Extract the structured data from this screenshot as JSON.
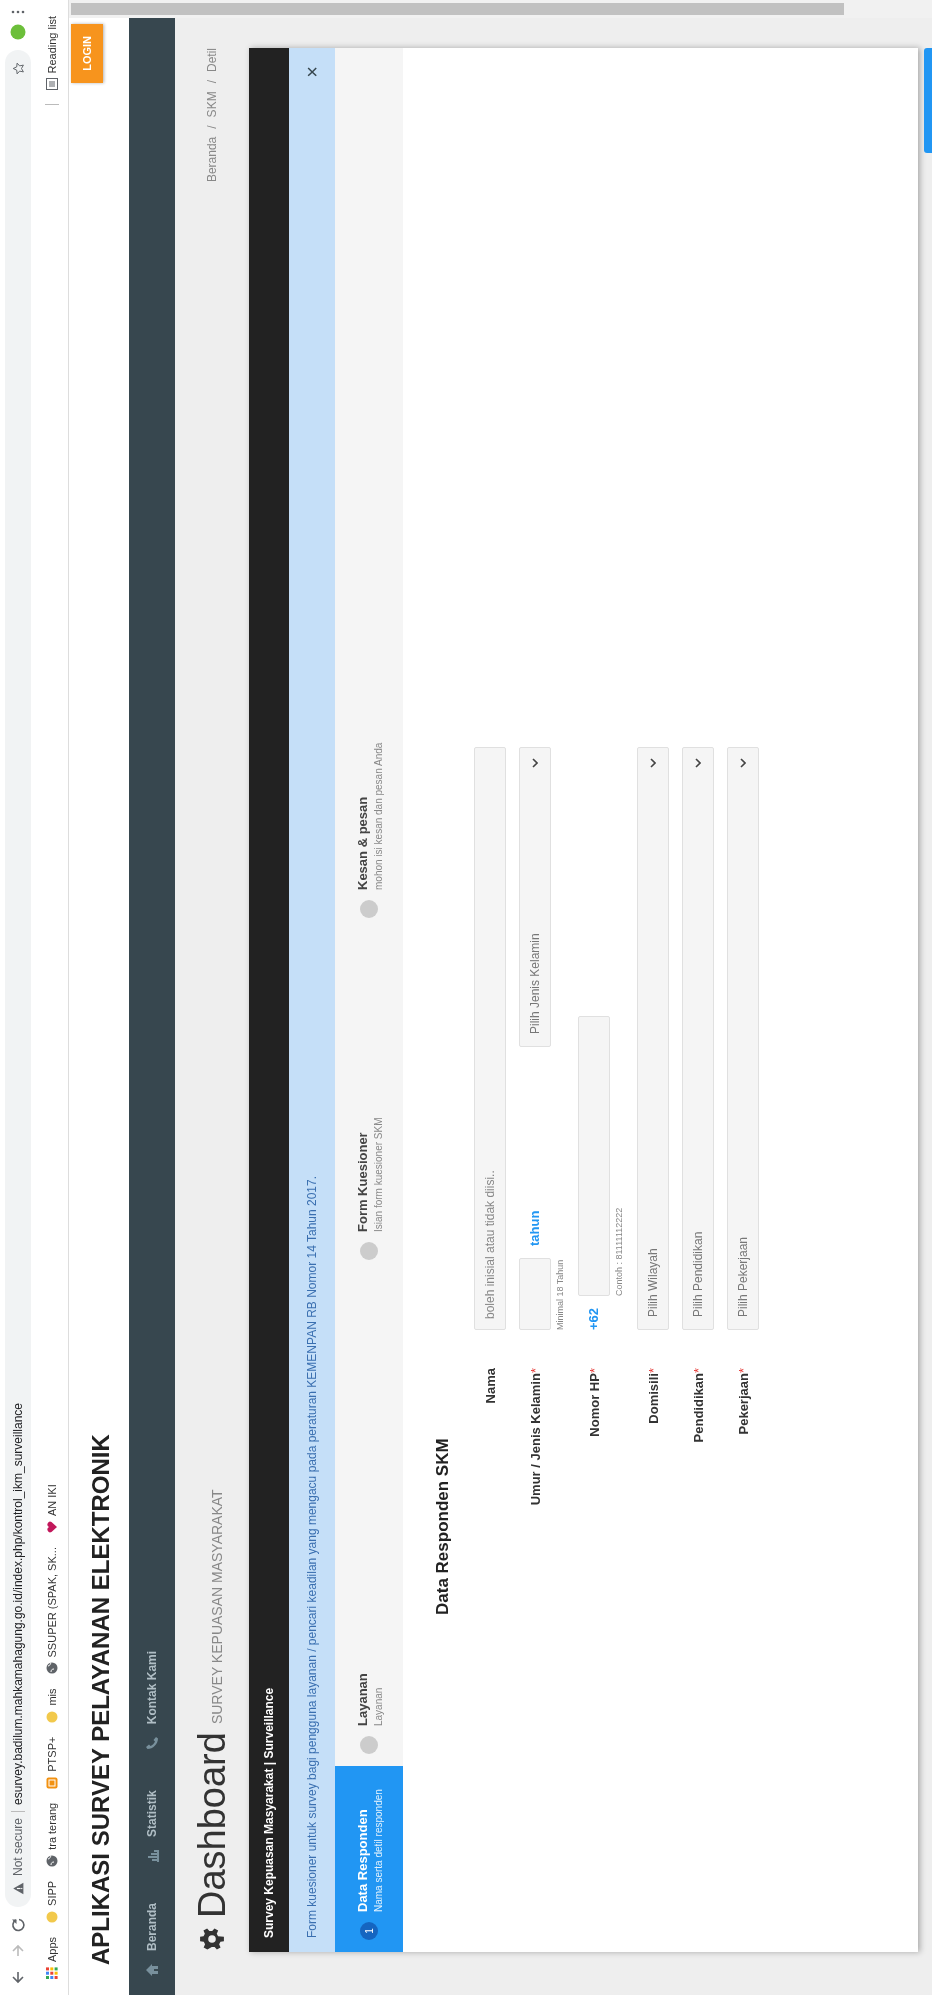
{
  "browser": {
    "security": "Not secure",
    "url": "esurvey.badilum.mahkamahagung.go.id/index.php/kontrol_ikm_surveillance",
    "bookmarks": [
      {
        "label": "Apps",
        "kind": "apps"
      },
      {
        "label": "SIPP",
        "kind": "dot"
      },
      {
        "label": "tra terang",
        "kind": "globe"
      },
      {
        "label": "PTSP+",
        "kind": "square"
      },
      {
        "label": "mis",
        "kind": "dot"
      },
      {
        "label": "SSUPER (SPAK, SK...",
        "kind": "globe"
      },
      {
        "label": "AN IKI",
        "kind": "heart"
      }
    ],
    "reading_list": "Reading list"
  },
  "app_title": "APLIKASI SURVEY PELAYANAN ELEKTRONIK",
  "login_button": "LOGIN",
  "nav": [
    {
      "label": "Beranda",
      "kind": "home"
    },
    {
      "label": "Statistik",
      "kind": "chart"
    },
    {
      "label": "Kontak Kami",
      "kind": "phone"
    }
  ],
  "page_title": "Dashboard",
  "page_subtitle": "SURVEY KEPUASAN MASYARAKAT",
  "breadcrumb": {
    "items": [
      "Beranda",
      "SKM",
      "Detil"
    ],
    "separator": "/"
  },
  "card": {
    "title": "Survey Kepuasan Masyarakat | Surveillance",
    "notice": "Form kuesioner untuk survey bagi pengguna layanan / pencari keadilan yang mengacu pada peraturan KEMENPAN RB Nomor 14 Tahun 2017.",
    "close": "×",
    "steps": [
      {
        "number": "1",
        "title": "Data Responden",
        "desc": "Nama serta detil responden",
        "selected": true
      },
      {
        "title": "Layanan",
        "desc": "Layanan",
        "selected": false
      },
      {
        "title": "Form Kuesioner",
        "desc": "Isian form kuesioner SKM",
        "selected": false
      },
      {
        "title": "Kesan & pesan",
        "desc": "mohon isi kesan dan pesan Anda",
        "selected": false
      }
    ],
    "section_title": "Data Responden SKM",
    "required_mark": "*",
    "fields": [
      {
        "kind": "text",
        "label": "Nama",
        "required": false,
        "placeholder": "boleh inisial atau tidak diisi.."
      },
      {
        "kind": "age_gender",
        "label": "Umur / Jenis Kelamin",
        "required": true,
        "unit": "tahun",
        "hint": "Minimal 18 Tahun",
        "select": "Pilih Jenis Kelamin"
      },
      {
        "kind": "phone",
        "label": "Nomor HP",
        "required": true,
        "prefix": "+62",
        "hint": "Contoh : 81111112222"
      },
      {
        "kind": "select",
        "label": "Domisili",
        "required": true,
        "select": "Pilih Wilayah"
      },
      {
        "kind": "select",
        "label": "Pendidikan",
        "required": true,
        "select": "Pilih Pendidikan"
      },
      {
        "kind": "select",
        "label": "Pekerjaan",
        "required": true,
        "select": "Pilih Pekerjaan"
      }
    ]
  }
}
